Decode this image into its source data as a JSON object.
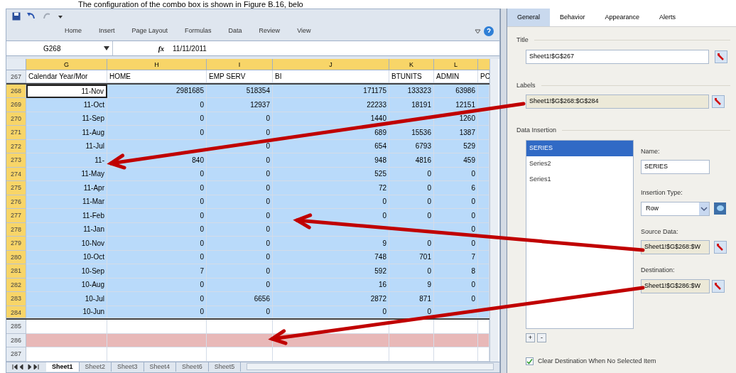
{
  "caption": "The configuration of the combo box is shown in Figure B.16, belo",
  "ribbon_tabs": [
    "Home",
    "Insert",
    "Page Layout",
    "Formulas",
    "Data",
    "Review",
    "View"
  ],
  "formula_bar": {
    "name_box": "G268",
    "function_label": "fx",
    "value": "11/11/2011"
  },
  "columns": [
    {
      "label": "G",
      "selected": true
    },
    {
      "label": "H",
      "selected": true
    },
    {
      "label": "I",
      "selected": true
    },
    {
      "label": "J",
      "selected": true
    },
    {
      "label": "K",
      "selected": true
    },
    {
      "label": "L",
      "selected": true
    }
  ],
  "rows": [
    {
      "number": "267",
      "kind": "header",
      "selected": false,
      "active": false,
      "cells": [
        "Calendar Year/Mor",
        "HOME",
        "EMP SERV",
        "BI",
        "BTUNITS",
        "ADMIN",
        "PC"
      ]
    },
    {
      "number": "268",
      "kind": "data",
      "selected": true,
      "active": true,
      "cells": [
        "11-Nov",
        "2981685",
        "518354",
        "171175",
        "133323",
        "63986"
      ]
    },
    {
      "number": "269",
      "kind": "data",
      "selected": true,
      "active": false,
      "cells": [
        "11-Oct",
        "0",
        "12937",
        "22233",
        "18191",
        "12151"
      ]
    },
    {
      "number": "270",
      "kind": "data",
      "selected": true,
      "active": false,
      "cells": [
        "11-Sep",
        "0",
        "0",
        "1440",
        null,
        "1260"
      ]
    },
    {
      "number": "271",
      "kind": "data",
      "selected": true,
      "active": false,
      "cells": [
        "11-Aug",
        "0",
        "0",
        "689",
        "15536",
        "1387"
      ]
    },
    {
      "number": "272",
      "kind": "data",
      "selected": true,
      "active": false,
      "cells": [
        "11-Jul",
        null,
        "0",
        "654",
        "6793",
        "529"
      ]
    },
    {
      "number": "273",
      "kind": "data",
      "selected": true,
      "active": false,
      "cells": [
        "11-",
        "840",
        "0",
        "948",
        "4816",
        "459"
      ]
    },
    {
      "number": "274",
      "kind": "data",
      "selected": true,
      "active": false,
      "cells": [
        "11-May",
        "0",
        "0",
        "525",
        "0",
        "0"
      ]
    },
    {
      "number": "275",
      "kind": "data",
      "selected": true,
      "active": false,
      "cells": [
        "11-Apr",
        "0",
        "0",
        "72",
        "0",
        "6"
      ]
    },
    {
      "number": "276",
      "kind": "data",
      "selected": true,
      "active": false,
      "cells": [
        "11-Mar",
        "0",
        "0",
        "0",
        "0",
        "0"
      ]
    },
    {
      "number": "277",
      "kind": "data",
      "selected": true,
      "active": false,
      "cells": [
        "11-Feb",
        "0",
        "0",
        "0",
        "0",
        "0"
      ]
    },
    {
      "number": "278",
      "kind": "data",
      "selected": true,
      "active": false,
      "cells": [
        "11-Jan",
        "0",
        "0",
        null,
        null,
        "0"
      ]
    },
    {
      "number": "279",
      "kind": "data",
      "selected": true,
      "active": false,
      "cells": [
        "10-Nov",
        "0",
        "0",
        "9",
        "0",
        "0"
      ]
    },
    {
      "number": "280",
      "kind": "data",
      "selected": true,
      "active": false,
      "cells": [
        "10-Oct",
        "0",
        "0",
        "748",
        "701",
        "7"
      ]
    },
    {
      "number": "281",
      "kind": "data",
      "selected": true,
      "active": false,
      "cells": [
        "10-Sep",
        "7",
        "0",
        "592",
        "0",
        "8"
      ]
    },
    {
      "number": "282",
      "kind": "data",
      "selected": true,
      "active": false,
      "cells": [
        "10-Aug",
        "0",
        "0",
        "16",
        "9",
        "0"
      ]
    },
    {
      "number": "283",
      "kind": "data",
      "selected": true,
      "active": false,
      "cells": [
        "10-Jul",
        "0",
        "6656",
        "2872",
        "871",
        "0"
      ]
    },
    {
      "number": "284",
      "kind": "data",
      "selected": true,
      "active": false,
      "cells": [
        "10-Jun",
        "0",
        "0",
        "0",
        "0",
        null
      ]
    },
    {
      "number": "285",
      "kind": "blank",
      "selected": false,
      "active": false
    },
    {
      "number": "286",
      "kind": "destination",
      "selected": false,
      "active": false
    },
    {
      "number": "287",
      "kind": "blank",
      "selected": false,
      "active": false
    }
  ],
  "sheet_tabs": [
    {
      "label": "Sheet1",
      "selected": true
    },
    {
      "label": "Sheet2",
      "selected": false
    },
    {
      "label": "Sheet3",
      "selected": false
    },
    {
      "label": "Sheet4",
      "selected": false
    },
    {
      "label": "Sheet6",
      "selected": false
    },
    {
      "label": "Sheet5",
      "selected": false
    }
  ],
  "panel": {
    "tabs": [
      {
        "label": "General",
        "selected": true
      },
      {
        "label": "Behavior",
        "selected": false
      },
      {
        "label": "Appearance",
        "selected": false
      },
      {
        "label": "Alerts",
        "selected": false
      }
    ],
    "title": {
      "heading": "Title",
      "value": "Sheet1!$G$267"
    },
    "labels": {
      "heading": "Labels",
      "value": "Sheet1!$G$268:$G$284"
    },
    "data_insertion": {
      "heading": "Data Insertion",
      "series": [
        {
          "label": "SERIES",
          "selected": true
        },
        {
          "label": "Series2",
          "selected": false
        },
        {
          "label": "Series1",
          "selected": false
        }
      ],
      "name_label": "Name:",
      "name": "SERIES",
      "insertion_type_label": "Insertion Type:",
      "insertion_type": "Row",
      "source_label": "Source Data:",
      "source": "Sheet1!$G$268:$W",
      "destination_label": "Destination:",
      "destination": "Sheet1!$G$286:$W",
      "add": "+",
      "remove": "-"
    },
    "clear_option": {
      "label": "Clear Destination When No Selected Item",
      "checked": true
    }
  }
}
